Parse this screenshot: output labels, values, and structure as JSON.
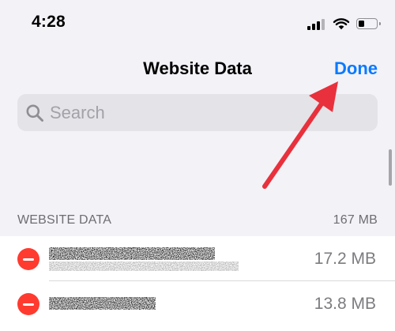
{
  "status_bar": {
    "time": "4:28",
    "signal_icon": "cellular-signal-icon",
    "wifi_icon": "wifi-icon",
    "battery_icon": "battery-icon",
    "battery_level": 0.35
  },
  "nav": {
    "title": "Website Data",
    "done_label": "Done"
  },
  "search": {
    "placeholder": "Search",
    "value": "",
    "icon": "magnifying-glass-icon"
  },
  "section": {
    "title": "WEBSITE DATA",
    "total": "167 MB"
  },
  "websites": [
    {
      "name": "",
      "size": "17.2 MB",
      "delete_icon": "minus-circle-icon"
    },
    {
      "name": "",
      "size": "13.8 MB",
      "delete_icon": "minus-circle-icon"
    }
  ],
  "colors": {
    "background": "#f2f2f7",
    "accent": "#0a7aff",
    "delete": "#ff3b30",
    "annotation_arrow": "#e8313c",
    "secondary_text": "#6d6d72"
  }
}
